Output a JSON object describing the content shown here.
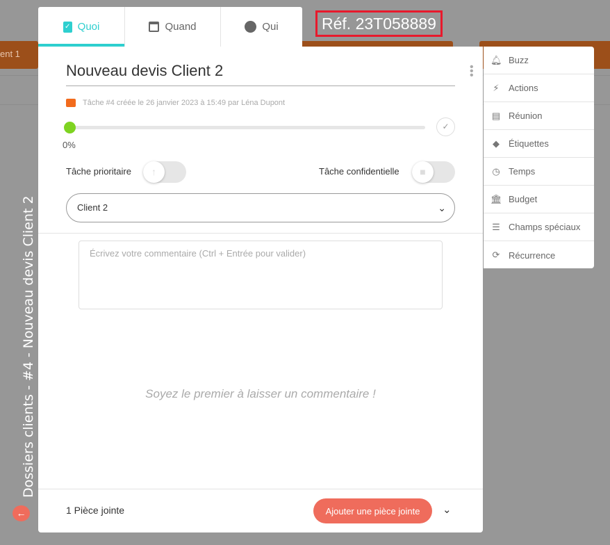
{
  "background": {
    "orange_label": "ent 1",
    "vertical_title": "Dossiers clients - #4 - Nouveau devis Client 2"
  },
  "tabs": [
    {
      "label": "Quoi",
      "icon": "clipboard-check-icon",
      "active": true
    },
    {
      "label": "Quand",
      "icon": "calendar-icon"
    },
    {
      "label": "Qui",
      "icon": "user-circle-icon"
    }
  ],
  "reference": "Réf. 23T058889",
  "task": {
    "title": "Nouveau devis Client 2",
    "meta": "Tâche #4 créée le 26 janvier 2023 à 15:49 par Léna Dupont",
    "progress_label": "0%",
    "progress": 0,
    "priority_label": "Tâche prioritaire",
    "priority_on": false,
    "confidential_label": "Tâche confidentielle",
    "confidential_on": false,
    "client": "Client 2"
  },
  "comment": {
    "placeholder": "Écrivez votre commentaire (Ctrl + Entrée pour valider)",
    "empty": "Soyez le premier à laisser un commentaire !"
  },
  "footer": {
    "attachments": "1 Pièce jointe",
    "add_button": "Ajouter une pièce jointe"
  },
  "menu": [
    {
      "label": "Buzz",
      "icon": "bell-icon"
    },
    {
      "label": "Actions",
      "icon": "lightning-icon"
    },
    {
      "label": "Réunion",
      "icon": "calendar-icon"
    },
    {
      "label": "Étiquettes",
      "icon": "tag-icon"
    },
    {
      "label": "Temps",
      "icon": "clock-icon"
    },
    {
      "label": "Budget",
      "icon": "bank-icon"
    },
    {
      "label": "Champs spéciaux",
      "icon": "list-icon"
    },
    {
      "label": "Récurrence",
      "icon": "refresh-icon"
    }
  ],
  "colors": {
    "accent": "#2ecfcf",
    "button": "#ef6c5c",
    "highlight": "#e8192c",
    "progress": "#7ed321"
  }
}
